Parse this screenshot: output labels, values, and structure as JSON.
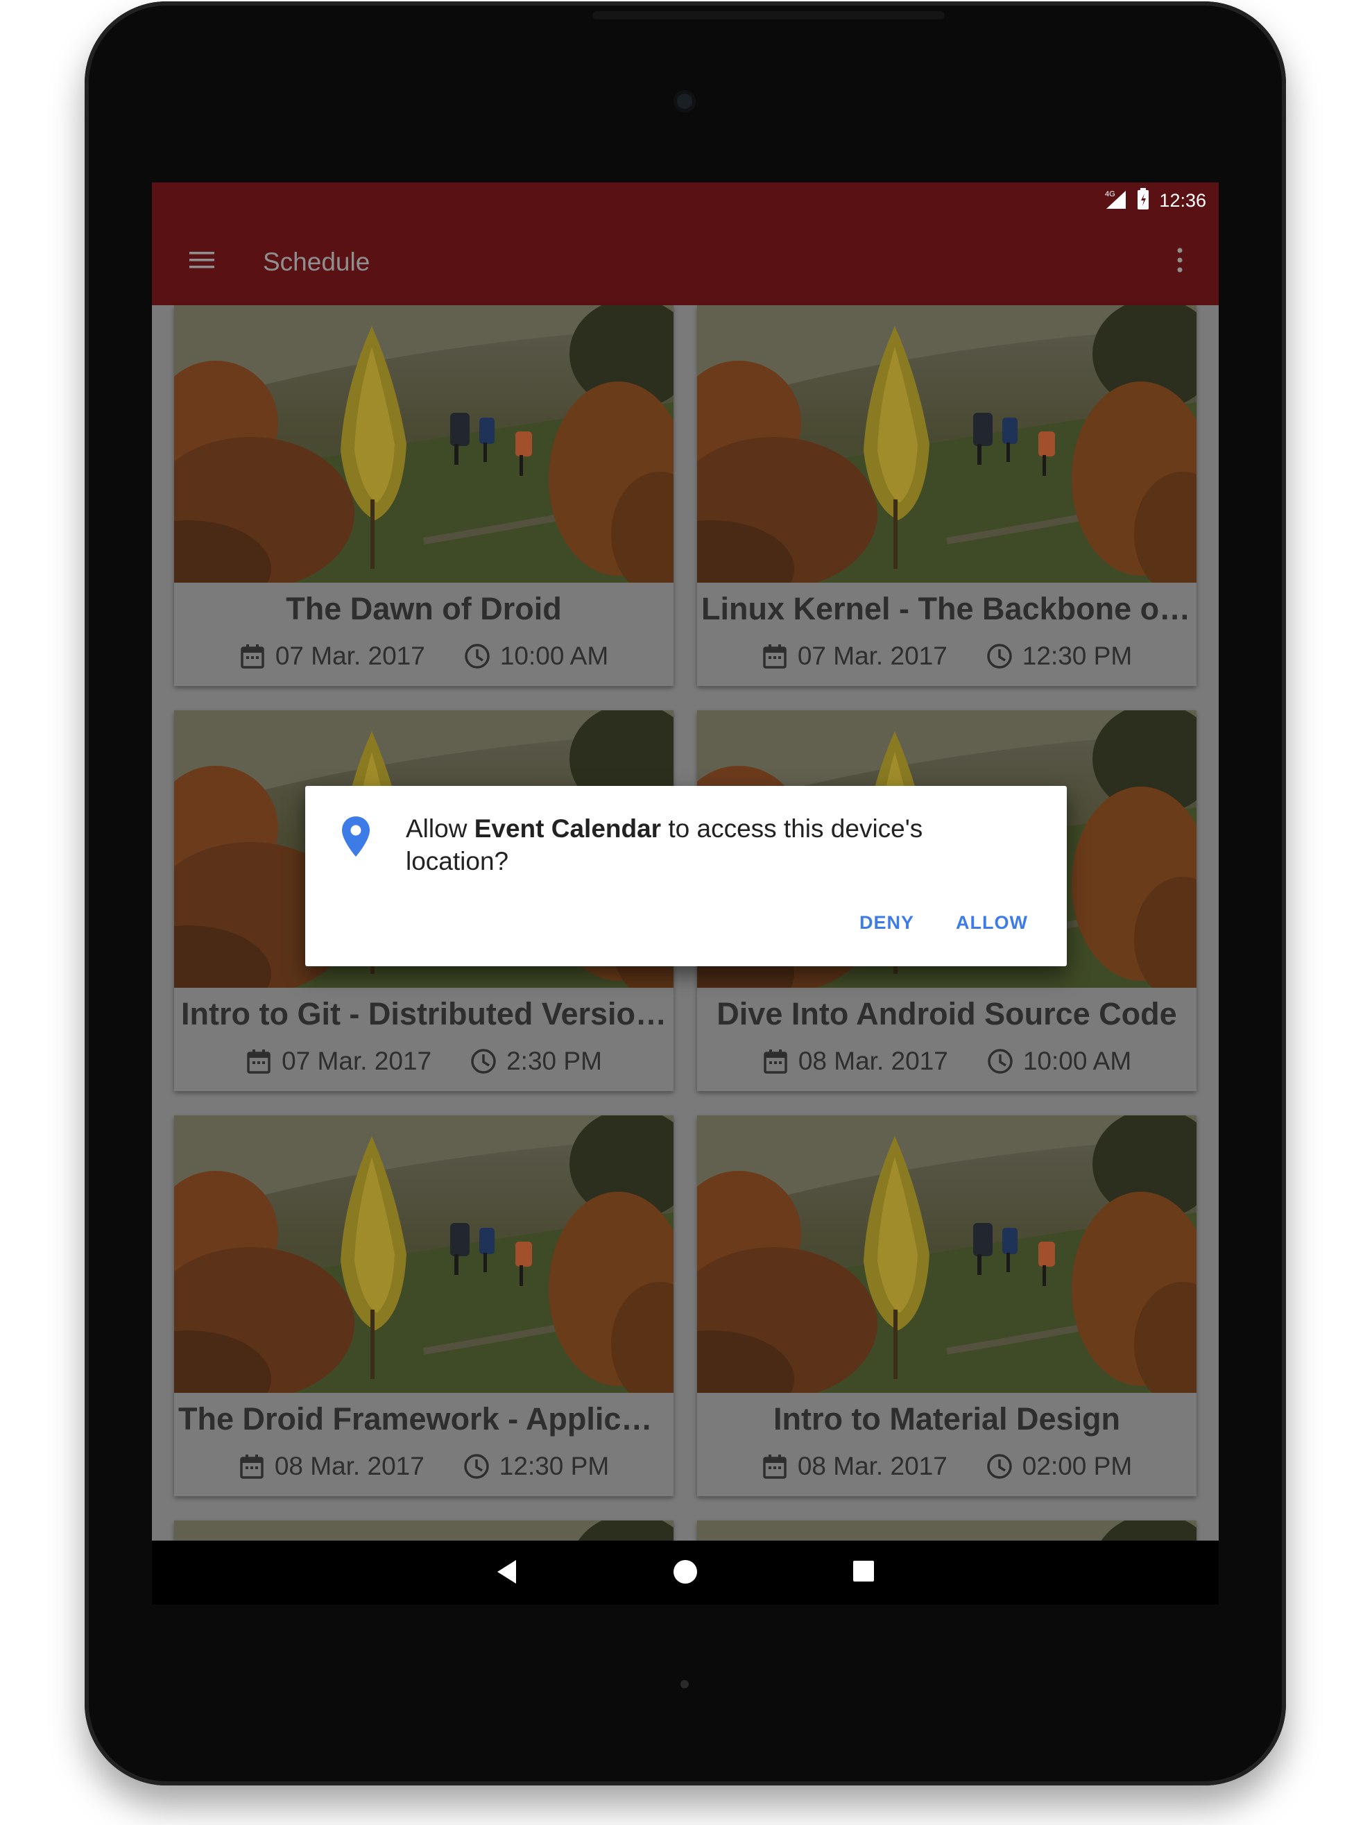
{
  "status_bar": {
    "network": "4G",
    "time": "12:36"
  },
  "app_bar": {
    "title": "Schedule"
  },
  "cards": [
    {
      "title": "The Dawn of Droid",
      "date": "07 Mar. 2017",
      "time": "10:00 AM"
    },
    {
      "title": "Linux Kernel - The Backbone of…",
      "date": "07 Mar. 2017",
      "time": "12:30 PM"
    },
    {
      "title": "Intro to Git - Distributed Versio…",
      "date": "07 Mar. 2017",
      "time": "2:30 PM"
    },
    {
      "title": "Dive Into Android Source Code",
      "date": "08 Mar. 2017",
      "time": "10:00 AM"
    },
    {
      "title": "The Droid Framework - Applica…",
      "date": "08 Mar. 2017",
      "time": "12:30 PM"
    },
    {
      "title": "Intro to Material Design",
      "date": "08 Mar. 2017",
      "time": "02:00 PM"
    }
  ],
  "dialog": {
    "message_prefix": "Allow ",
    "app_name": "Event Calendar",
    "message_suffix": " to access this device's location?",
    "deny_label": "DENY",
    "allow_label": "ALLOW"
  },
  "icons": {
    "menu": "menu-icon",
    "overflow": "more-vert-icon",
    "date": "calendar-icon",
    "time": "clock-icon",
    "location": "location-pin-icon"
  },
  "colors": {
    "app_bar": "#5a1113",
    "dialog_accent": "#3d7ce6"
  }
}
